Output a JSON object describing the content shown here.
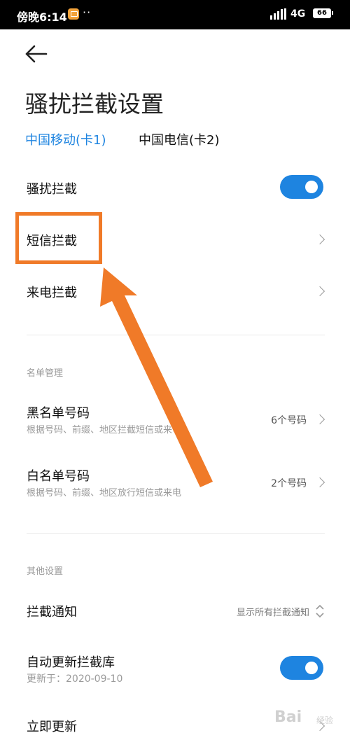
{
  "status_bar": {
    "time": "傍晚6:14",
    "dots": "··",
    "network": "4G",
    "battery": "66"
  },
  "header": {
    "back_icon": "arrow-left-icon",
    "title": "骚扰拦截设置"
  },
  "sim_tabs": [
    {
      "label": "中国移动(卡1)",
      "active": true
    },
    {
      "label": "中国电信(卡2)",
      "active": false
    }
  ],
  "settings": {
    "harass_block": {
      "label": "骚扰拦截",
      "enabled": true
    },
    "sms_block": {
      "label": "短信拦截"
    },
    "call_block": {
      "label": "来电拦截"
    }
  },
  "list_management": {
    "section_title": "名单管理",
    "blacklist": {
      "label": "黑名单号码",
      "sub": "根据号码、前缀、地区拦截短信或来电",
      "value": "6个号码"
    },
    "whitelist": {
      "label": "白名单号码",
      "sub": "根据号码、前缀、地区放行短信或来电",
      "value": "2个号码"
    }
  },
  "other_settings": {
    "section_title": "其他设置",
    "block_notify": {
      "label": "拦截通知",
      "value": "显示所有拦截通知"
    },
    "auto_update": {
      "label": "自动更新拦截库",
      "sub": "更新于：2020-09-10",
      "enabled": true
    },
    "update_now": {
      "label": "立即更新"
    }
  },
  "watermark": {
    "text": "Bai",
    "sub": "经验"
  },
  "colors": {
    "accent": "#1e84e0",
    "highlight": "#f07a28"
  }
}
